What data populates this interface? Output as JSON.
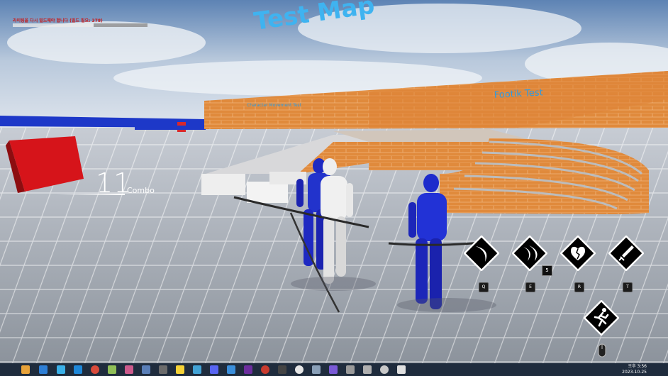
{
  "world": {
    "title_3d": "Test Map",
    "wall_sign": "Footik Test",
    "small_wall_sign": "Character Movement Test"
  },
  "debug": {
    "line1": "라이팅을 다시 빌드해야 합니다 (빌드 필요: 378)",
    "line2": ""
  },
  "combo": {
    "count": "11",
    "label": "Combo"
  },
  "skills": [
    {
      "key": "Q",
      "icon": "crescent-slash-icon"
    },
    {
      "key": "E",
      "icon": "double-crescent-icon",
      "count": "5"
    },
    {
      "key": "R",
      "icon": "broken-heart-icon"
    },
    {
      "key": "T",
      "icon": "sword-stab-icon"
    }
  ],
  "dash": {
    "icon": "running-man-icon",
    "key_icon": "mouse-icon"
  },
  "taskbar": {
    "time": "오후 3:56",
    "date": "2023-10-25"
  }
}
